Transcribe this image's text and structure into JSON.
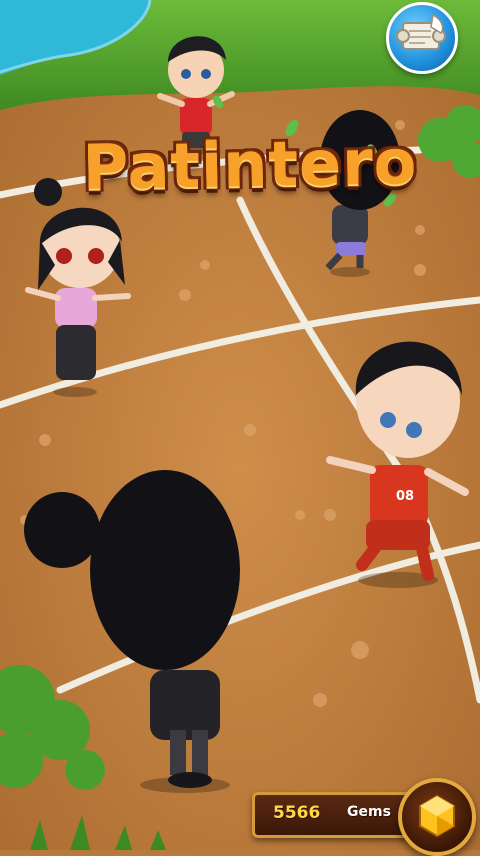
{
  "game": {
    "title": "Patintero",
    "currency": {
      "count": "5566",
      "label": "Gems"
    },
    "icons": {
      "quest": "scroll-quill-icon",
      "currency": "gem-icon"
    },
    "colors": {
      "court": "#b87a3c",
      "grass": "#4f9e2a",
      "water": "#2bb6d6",
      "lines": "#f3efe4",
      "title": "#f7a12a"
    }
  }
}
